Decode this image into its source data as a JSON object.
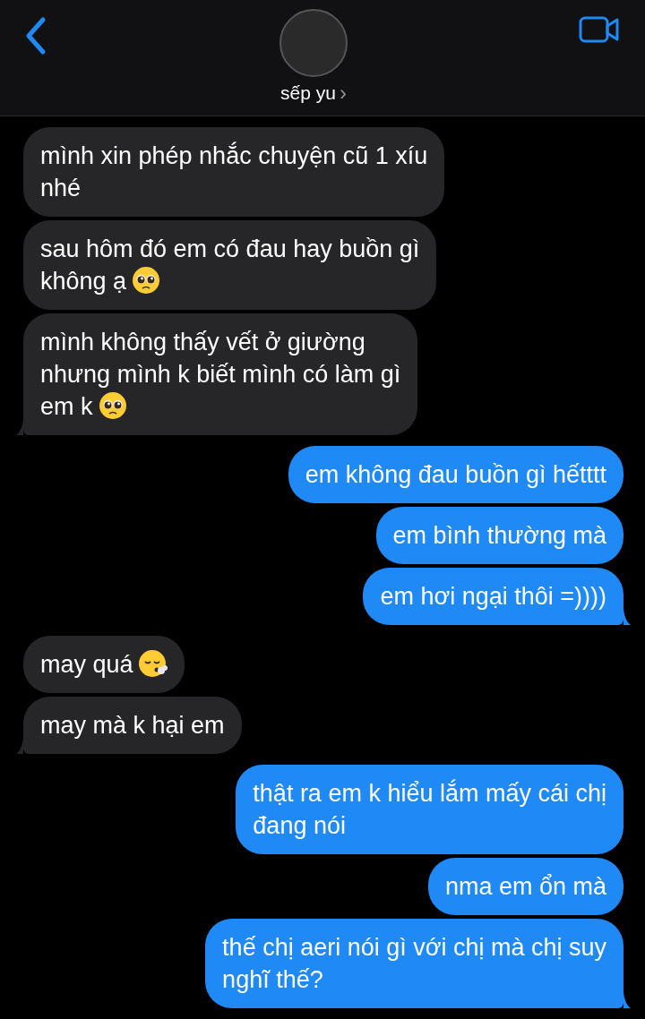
{
  "header": {
    "contact_name": "sếp yu",
    "name_chevron": "›"
  },
  "groups": [
    {
      "kind": "incoming",
      "messages": [
        {
          "text": "mình xin phép nhắc chuyện cũ 1 xíu\nnhé"
        },
        {
          "text": "sau hôm đó em có đau hay buồn gì\nkhông ạ",
          "emoji": {
            "kind": "pleading"
          }
        },
        {
          "text": "mình không thấy vết ở giường\nnhưng mình k biết mình có làm gì\nem k",
          "emoji": {
            "kind": "pleading"
          }
        }
      ]
    },
    {
      "kind": "outgoing",
      "messages": [
        {
          "text": "em không đau buồn gì hếtttt"
        },
        {
          "text": "em bình thường mà"
        },
        {
          "text": "em hơi ngại thôi =))))"
        }
      ]
    },
    {
      "kind": "incoming",
      "messages": [
        {
          "text": "may quá",
          "emoji": {
            "kind": "exhaling"
          }
        },
        {
          "text": "may mà k hại em"
        }
      ]
    },
    {
      "kind": "outgoing",
      "messages": [
        {
          "text": "thật ra em k hiểu lắm mấy cái chị\nđang nói"
        },
        {
          "text": "nma em ổn mà"
        },
        {
          "text": "thế chị aeri nói gì với chị mà chị suy\nnghĩ thế?"
        }
      ]
    }
  ]
}
